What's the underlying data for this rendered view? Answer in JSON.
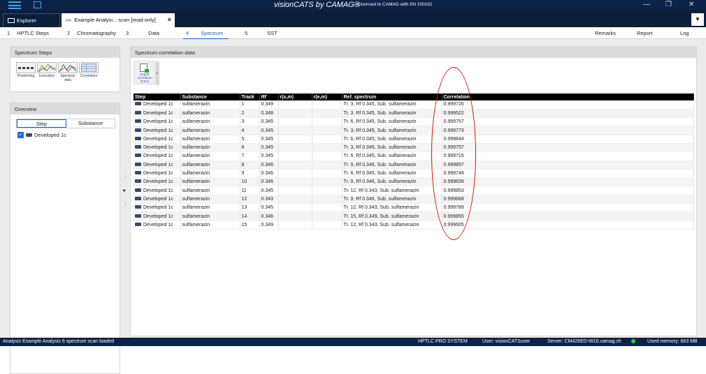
{
  "titlebar": {
    "brand": "visionCATS by CAMAG®",
    "license": "Licensed to CAMAG with SN 100151"
  },
  "tabs": {
    "explorer": "Explorer",
    "analysis_tag": "AIB",
    "analysis": "Example Analysi... scan [read-only]",
    "close": "×"
  },
  "steps": [
    {
      "num": "1",
      "label": "HPTLC Steps"
    },
    {
      "num": "2",
      "label": "Chromatography"
    },
    {
      "num": "3",
      "label": "Data"
    },
    {
      "num": "4",
      "label": "Spectrum"
    },
    {
      "num": "5",
      "label": "SST"
    }
  ],
  "rightnav": {
    "remarks": "Remarks",
    "report": "Report",
    "log": "Log"
  },
  "left": {
    "spectrum_steps_title": "Spectrum Steps",
    "step_icons": [
      "Positioning",
      "Execution",
      "Spectrum data",
      "Correlation"
    ],
    "overview_title": "Overview",
    "seg_step": "Step",
    "seg_substance": "Substance",
    "tree_item": "Developed 1c"
  },
  "main": {
    "title": "Spectrum correlation data",
    "export_label": "Export correlation (CSV)"
  },
  "table": {
    "headers": [
      "Step",
      "Substance",
      "Track",
      "Rf",
      "r(s,m)",
      "r(e,m)",
      "Ref. spectrum",
      "Correlation"
    ],
    "rows": [
      [
        "Developed 1c",
        "sulfamerazin",
        "1",
        "0.349",
        "",
        "",
        "Tr. 3, Rf 0.345, Sub. sulfamerazin",
        "0.999726"
      ],
      [
        "Developed 1c",
        "sulfamerazin",
        "2",
        "0.348",
        "",
        "",
        "Tr. 3, Rf 0.345, Sub. sulfamerazin",
        "0.999522"
      ],
      [
        "Developed 1c",
        "sulfamerazin",
        "3",
        "0.345",
        "",
        "",
        "Tr. 6, Rf 0.345, Sub. sulfamerazin",
        "0.999757"
      ],
      [
        "Developed 1c",
        "sulfamerazin",
        "4",
        "0.345",
        "",
        "",
        "Tr. 3, Rf 0.345, Sub. sulfamerazin",
        "0.999773"
      ],
      [
        "Developed 1c",
        "sulfamerazin",
        "5",
        "0.345",
        "",
        "",
        "Tr. 6, Rf 0.345, Sub. sulfamerazin",
        "0.999844"
      ],
      [
        "Developed 1c",
        "sulfamerazin",
        "6",
        "0.345",
        "",
        "",
        "Tr. 3, Rf 0.345, Sub. sulfamerazin",
        "0.999757"
      ],
      [
        "Developed 1c",
        "sulfamerazin",
        "7",
        "0.345",
        "",
        "",
        "Tr. 6, Rf 0.345, Sub. sulfamerazin",
        "0.999715"
      ],
      [
        "Developed 1c",
        "sulfamerazin",
        "8",
        "0.346",
        "",
        "",
        "Tr. 9, Rf 0.346, Sub. sulfamerazin",
        "0.999857"
      ],
      [
        "Developed 1c",
        "sulfamerazin",
        "9",
        "0.346",
        "",
        "",
        "Tr. 6, Rf 0.345, Sub. sulfamerazin",
        "0.999749"
      ],
      [
        "Developed 1c",
        "sulfamerazin",
        "10",
        "0.346",
        "",
        "",
        "Tr. 9, Rf 0.346, Sub. sulfamerazin",
        "0.999839"
      ],
      [
        "Developed 1c",
        "sulfamerazin",
        "11",
        "0.345",
        "",
        "",
        "Tr. 12, Rf 0.343, Sub. sulfamerazin",
        "0.999853"
      ],
      [
        "Developed 1c",
        "sulfamerazin",
        "12",
        "0.343",
        "",
        "",
        "Tr. 9, Rf 0.346, Sub. sulfamerazin",
        "0.999668"
      ],
      [
        "Developed 1c",
        "sulfamerazin",
        "13",
        "0.345",
        "",
        "",
        "Tr. 12, Rf 0.343, Sub. sulfamerazin",
        "0.999789"
      ],
      [
        "Developed 1c",
        "sulfamerazin",
        "14",
        "0.346",
        "",
        "",
        "Tr. 15, Rf 0.349, Sub. sulfamerazin",
        "0.999855"
      ],
      [
        "Developed 1c",
        "sulfamerazin",
        "15",
        "0.349",
        "",
        "",
        "Tr. 12, Rf 0.343, Sub. sulfamerazin",
        "0.999605"
      ]
    ]
  },
  "status": {
    "message": "Analysis Example Analysis 6 spectrum scan loaded",
    "system": "HPTLC PRO SYSTEM",
    "user": "User: visionCATSuser",
    "server": "Server: CM426ED-W10.camag.ch",
    "memory": "Used memory: 663 MB"
  },
  "colors": {
    "accent": "#1a5fb4",
    "titlebar": "#0b2347",
    "highlight": "#d01010"
  }
}
